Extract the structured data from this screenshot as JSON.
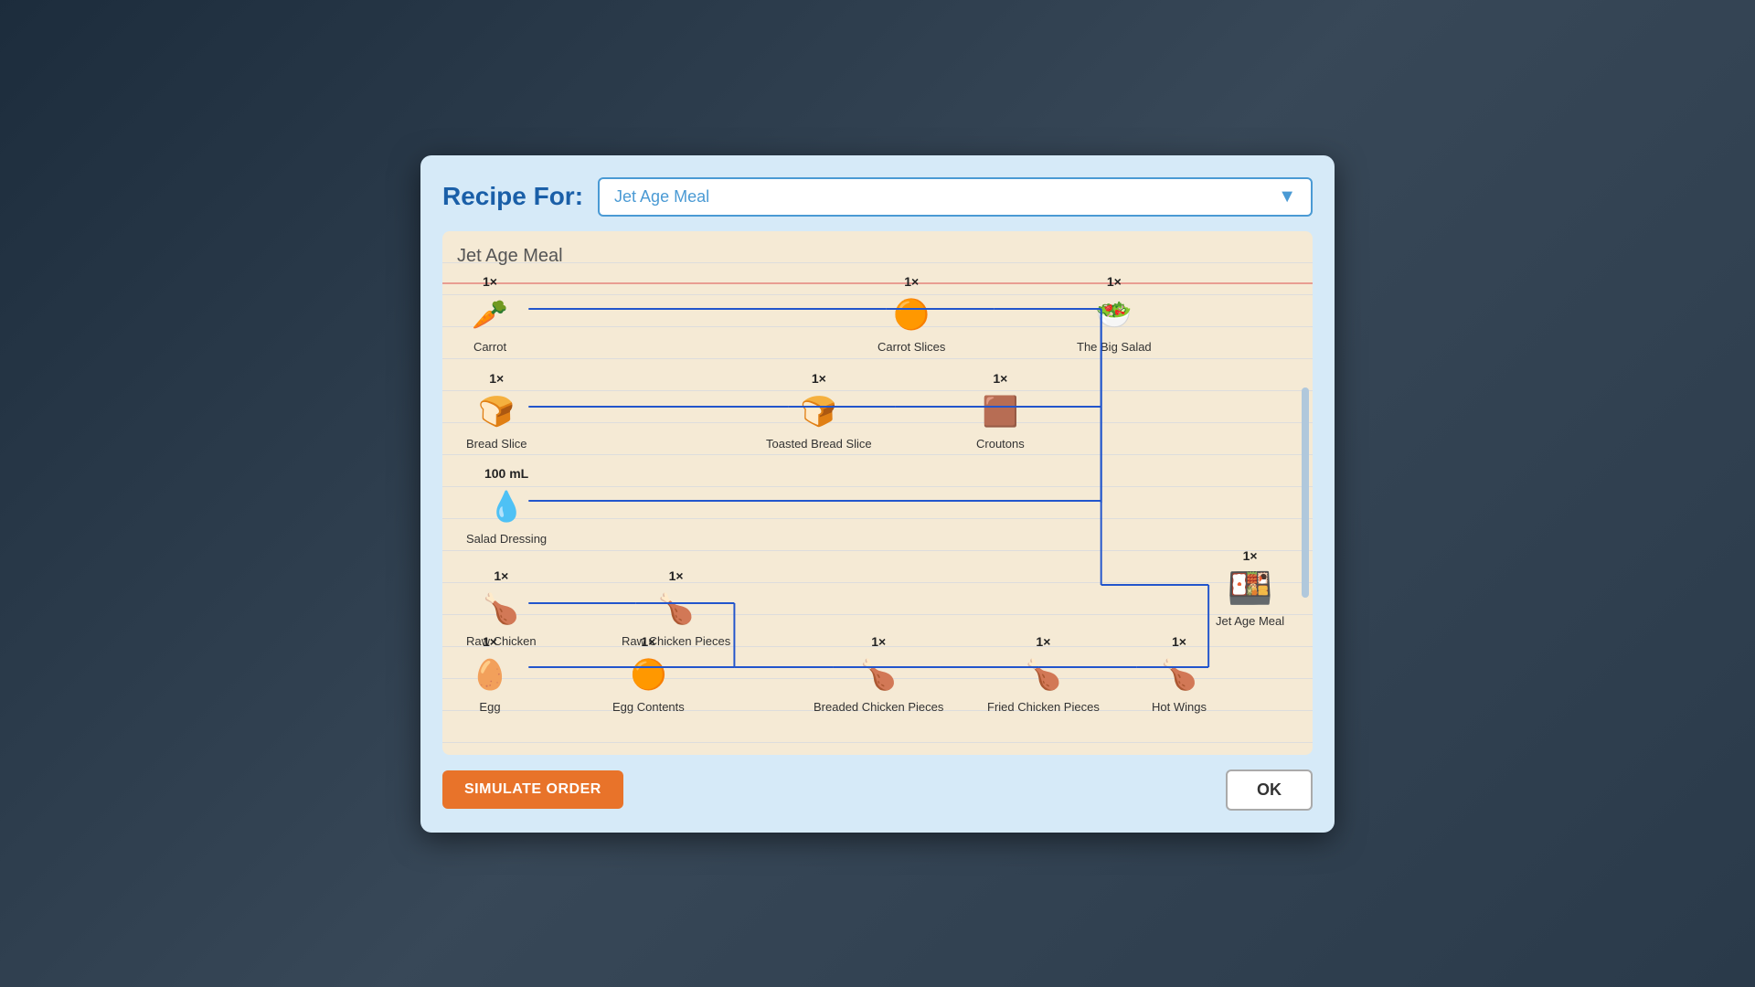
{
  "modal": {
    "recipe_for_label": "Recipe For:",
    "dropdown_value": "Jet Age Meal",
    "recipe_title": "Jet Age Meal",
    "simulate_btn": "SIMULATE ORDER",
    "ok_btn": "OK"
  },
  "nodes": {
    "carrot": {
      "qty": "1×",
      "label": "Carrot",
      "icon": "🥕"
    },
    "carrot_slices": {
      "qty": "1×",
      "label": "Carrot Slices",
      "icon": "🍊"
    },
    "big_salad": {
      "qty": "1×",
      "label": "The Big Salad",
      "icon": "🥗"
    },
    "bread_slice": {
      "qty": "1×",
      "label": "Bread Slice",
      "icon": "🍞"
    },
    "toasted_bread": {
      "qty": "1×",
      "label": "Toasted Bread Slice",
      "icon": "🍞"
    },
    "croutons": {
      "qty": "1×",
      "label": "Croutons",
      "icon": "🟫"
    },
    "salad_dressing": {
      "qty": "100 mL",
      "label": "Salad Dressing",
      "icon": "💧"
    },
    "jet_age_meal": {
      "qty": "1×",
      "label": "Jet Age Meal",
      "icon": "🍱"
    },
    "raw_chicken": {
      "qty": "1×",
      "label": "Raw Chicken",
      "icon": "🍗"
    },
    "raw_chicken_pieces": {
      "qty": "1×",
      "label": "Raw Chicken Pieces",
      "icon": "🍗"
    },
    "egg": {
      "qty": "1×",
      "label": "Egg",
      "icon": "🥚"
    },
    "egg_contents": {
      "qty": "1×",
      "label": "Egg Contents",
      "icon": "🟠"
    },
    "breaded_chicken": {
      "qty": "1×",
      "label": "Breaded Chicken Pieces",
      "icon": "🍗"
    },
    "fried_chicken": {
      "qty": "1×",
      "label": "Fried Chicken Pieces",
      "icon": "🍗"
    },
    "hot_wings": {
      "qty": "1×",
      "label": "Hot Wings",
      "icon": "🍗"
    }
  }
}
